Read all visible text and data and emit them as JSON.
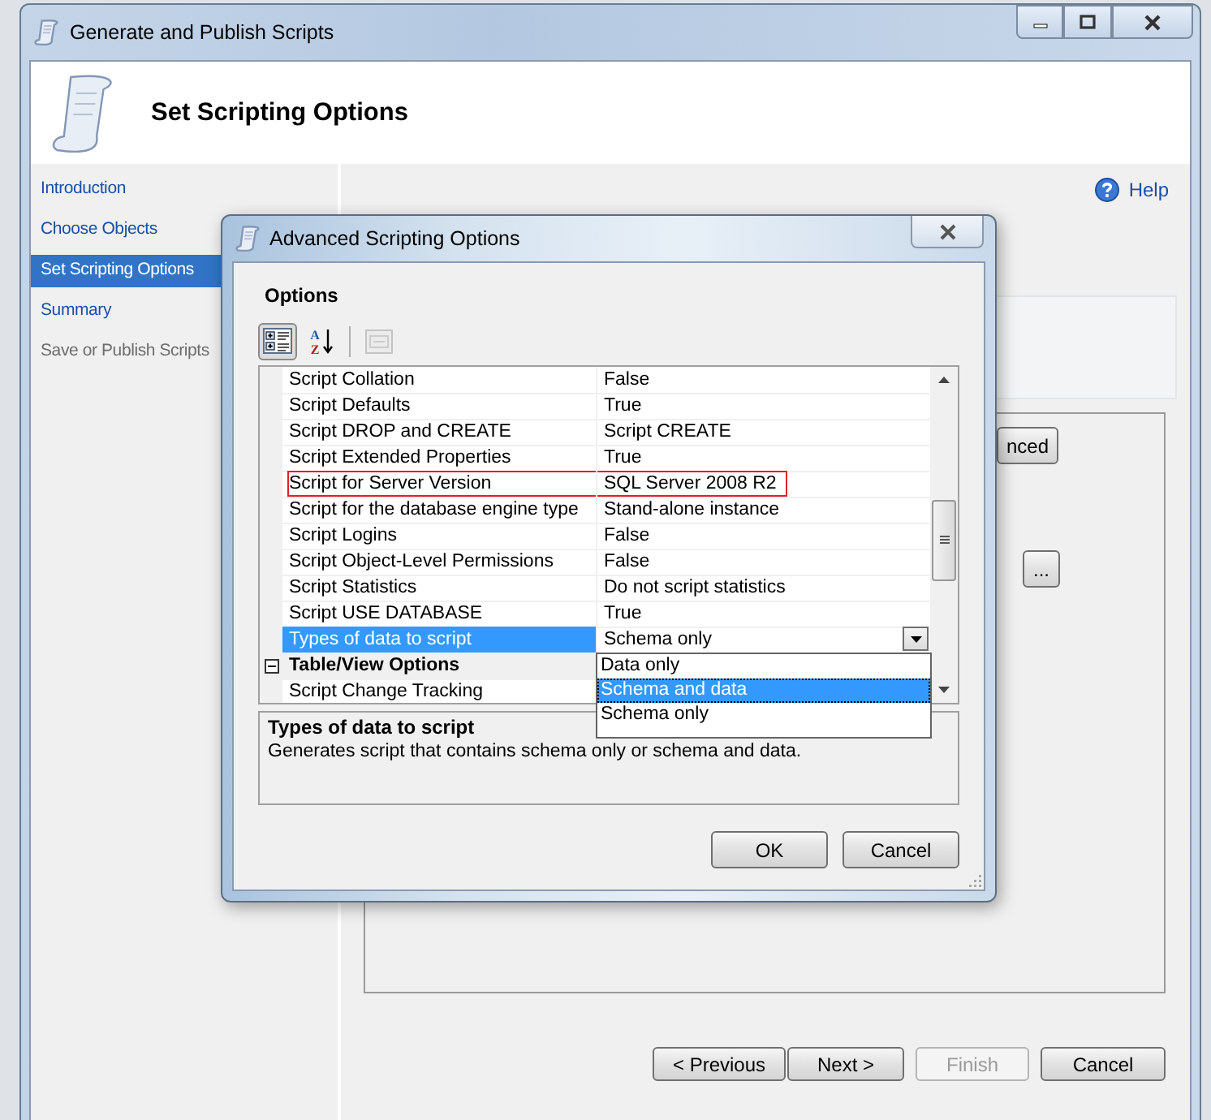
{
  "window": {
    "title": "Generate and Publish Scripts"
  },
  "header": {
    "title": "Set Scripting Options"
  },
  "sidebar": {
    "items": [
      {
        "label": "Introduction",
        "selected": false,
        "disabled": false
      },
      {
        "label": "Choose Objects",
        "selected": false,
        "disabled": false
      },
      {
        "label": "Set Scripting Options",
        "selected": true,
        "disabled": false
      },
      {
        "label": "Summary",
        "selected": false,
        "disabled": false
      },
      {
        "label": "Save or Publish Scripts",
        "selected": false,
        "disabled": true
      }
    ]
  },
  "help_link": "Help",
  "background_controls": {
    "advanced_button": "nced",
    "browse_button": "..."
  },
  "buttons": [
    {
      "label": "< Previous",
      "disabled": false
    },
    {
      "label": "Next >",
      "disabled": false
    },
    {
      "label": "Finish",
      "disabled": true
    },
    {
      "label": "Cancel",
      "disabled": false
    }
  ],
  "dialog": {
    "title": "Advanced Scripting Options",
    "section_label": "Options",
    "toolbar": [
      {
        "kind": "categorized",
        "selected": true,
        "disabled": false
      },
      {
        "kind": "alphabetical",
        "letters": [
          "A",
          "Z"
        ],
        "selected": false,
        "disabled": false
      },
      {
        "kind": "property-pages",
        "selected": false,
        "disabled": true
      }
    ],
    "grid": {
      "rows": [
        {
          "kind": "property",
          "name": "Script Collation",
          "value": "False",
          "selected": false,
          "highlighted": false
        },
        {
          "kind": "property",
          "name": "Script Defaults",
          "value": "True",
          "selected": false,
          "highlighted": false
        },
        {
          "kind": "property",
          "name": "Script DROP and CREATE",
          "value": "Script CREATE",
          "selected": false,
          "highlighted": false
        },
        {
          "kind": "property",
          "name": "Script Extended Properties",
          "value": "True",
          "selected": false,
          "highlighted": false
        },
        {
          "kind": "property",
          "name": "Script for Server Version",
          "value": "SQL Server 2008 R2",
          "selected": false,
          "highlighted": true
        },
        {
          "kind": "property",
          "name": "Script for the database engine type",
          "value": "Stand-alone instance",
          "selected": false,
          "highlighted": false
        },
        {
          "kind": "property",
          "name": "Script Logins",
          "value": "False",
          "selected": false,
          "highlighted": false
        },
        {
          "kind": "property",
          "name": "Script Object-Level Permissions",
          "value": "False",
          "selected": false,
          "highlighted": false
        },
        {
          "kind": "property",
          "name": "Script Statistics",
          "value": "Do not script statistics",
          "selected": false,
          "highlighted": false
        },
        {
          "kind": "property",
          "name": "Script USE DATABASE",
          "value": "True",
          "selected": false,
          "highlighted": false
        },
        {
          "kind": "property",
          "name": "Types of data to script",
          "value": "Schema only",
          "selected": true,
          "highlighted": false
        },
        {
          "kind": "category",
          "name": "Table/View Options",
          "expanded": true,
          "selected": false
        },
        {
          "kind": "property",
          "name": "Script Change Tracking",
          "value": "",
          "selected": false,
          "highlighted": false
        }
      ],
      "dropdown": {
        "options": [
          {
            "label": "Data only",
            "selected": false
          },
          {
            "label": "Schema and data",
            "selected": true
          },
          {
            "label": "Schema only",
            "selected": false
          }
        ]
      }
    },
    "description": {
      "title": "Types of data to script",
      "text": "Generates script that contains schema only or schema and data."
    },
    "buttons": [
      "OK",
      "Cancel"
    ]
  }
}
